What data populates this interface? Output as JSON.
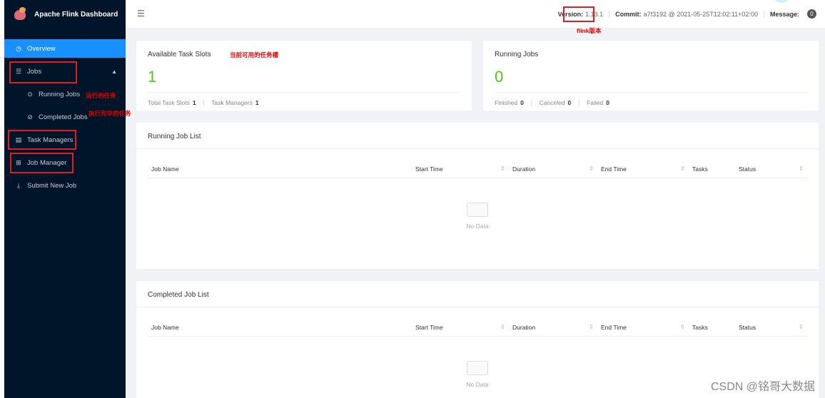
{
  "app": {
    "title": "Apache Flink Dashboard"
  },
  "sidebar": {
    "items": [
      {
        "label": "Overview",
        "icon": "dashboard-icon"
      },
      {
        "label": "Jobs",
        "icon": "list-icon"
      },
      {
        "label": "Running Jobs",
        "icon": "play-circle-icon"
      },
      {
        "label": "Completed Jobs",
        "icon": "check-circle-icon"
      },
      {
        "label": "Task Managers",
        "icon": "server-icon"
      },
      {
        "label": "Job Manager",
        "icon": "cluster-icon"
      },
      {
        "label": "Submit New Job",
        "icon": "upload-icon"
      }
    ]
  },
  "header": {
    "version_label": "Version:",
    "version_value": "1.13.1",
    "commit_label": "Commit:",
    "commit_value": "a7f3192 @ 2021-05-25T12:02:11+02:00",
    "message_label": "Message:",
    "message_count": "0"
  },
  "cards": {
    "task_slots": {
      "title": "Available Task Slots",
      "value": "1",
      "total_label": "Total Task Slots",
      "total_value": "1",
      "tm_label": "Task Managers",
      "tm_value": "1"
    },
    "running_jobs": {
      "title": "Running Jobs",
      "value": "0",
      "finished_label": "Finished",
      "finished_value": "0",
      "canceled_label": "Canceled",
      "canceled_value": "0",
      "failed_label": "Failed",
      "failed_value": "0"
    }
  },
  "running_list": {
    "title": "Running Job List",
    "columns": [
      "Job Name",
      "Start Time",
      "Duration",
      "End Time",
      "Tasks",
      "Status"
    ],
    "empty": "No Data"
  },
  "completed_list": {
    "title": "Completed Job List",
    "columns": [
      "Job Name",
      "Start Time",
      "Duration",
      "End Time",
      "Tasks",
      "Status"
    ],
    "empty": "No Data"
  },
  "annotations": {
    "version": "flink版本",
    "task_slots": "当前可用的任务槽",
    "running": "运行的任务",
    "completed": "执行完毕的任务"
  },
  "watermark": "CSDN @铭哥大数据",
  "colors": {
    "sidebar_bg": "#001529",
    "active": "#1890ff",
    "success": "#52c41a",
    "annotation": "#e60000"
  }
}
